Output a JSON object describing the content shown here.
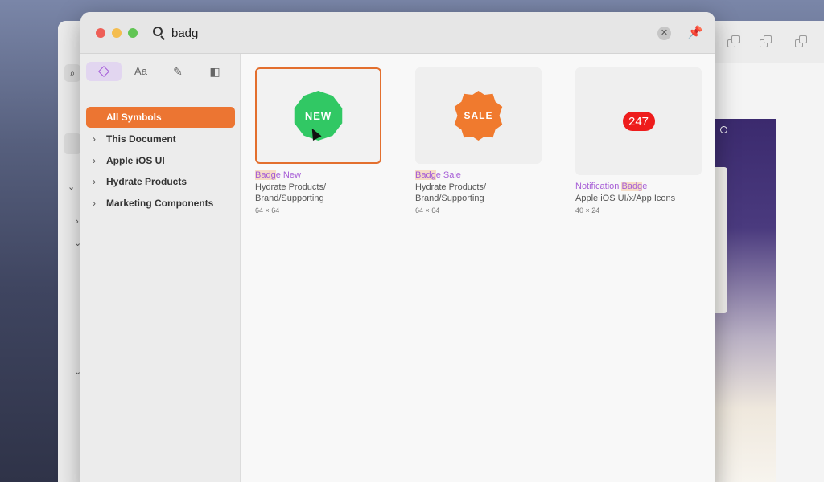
{
  "search": {
    "value": "badg"
  },
  "sidebar": {
    "segments": [
      {
        "name": "symbols",
        "label": "",
        "active": true
      },
      {
        "name": "text-styles",
        "label": "Aa",
        "active": false
      },
      {
        "name": "layer-styles",
        "label": "",
        "active": false
      },
      {
        "name": "colors",
        "label": "",
        "active": false
      }
    ],
    "items": [
      {
        "label": "All Symbols",
        "active": true
      },
      {
        "label": "This Document"
      },
      {
        "label": "Apple iOS UI"
      },
      {
        "label": "Hydrate Products"
      },
      {
        "label": "Marketing Components"
      }
    ]
  },
  "results": [
    {
      "title_highlight": "Badg",
      "title_rest": "e New",
      "path_line1": "Hydrate Products/",
      "path_line2": "Brand/Supporting",
      "size": "64 × 64",
      "badge_text": "NEW",
      "badge_color": "#31c864",
      "selected": true
    },
    {
      "title_highlight": "Badg",
      "title_rest": "e Sale",
      "path_line1": "Hydrate Products/",
      "path_line2": "Brand/Supporting",
      "size": "64 × 64",
      "badge_text": "SALE",
      "badge_color": "#f07a2e",
      "selected": false
    },
    {
      "title_prefix": "Notification ",
      "title_highlight": "Badg",
      "title_rest": "e",
      "path_line1": "Apple iOS UI/x/App Icons",
      "size": "40 × 24",
      "badge_text": "247",
      "badge_color": "#ee1c1c",
      "selected": false
    }
  ],
  "colors": {
    "accent": "#ec7532",
    "title": "#a65dd6",
    "highlight": "#f6dcc6"
  }
}
